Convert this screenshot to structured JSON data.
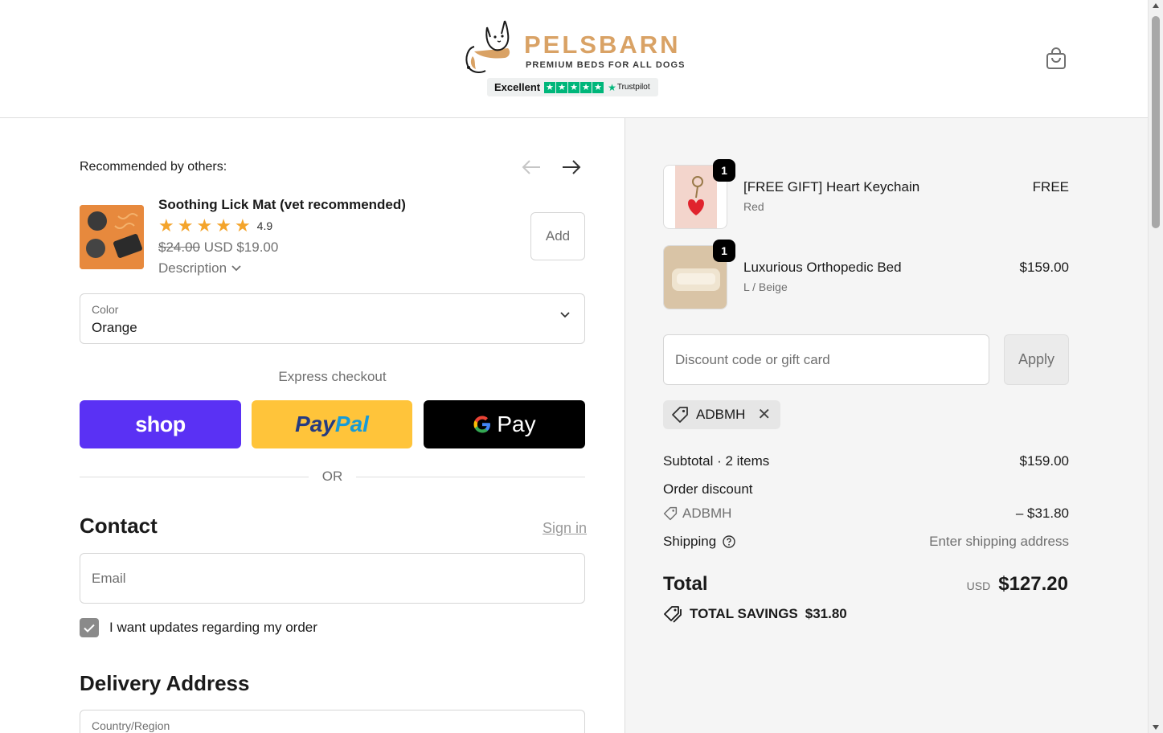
{
  "header": {
    "brand_name": "PELSBARN",
    "brand_tagline": "PREMIUM BEDS FOR ALL DOGS",
    "trustpilot": {
      "rating_text": "Excellent",
      "stars": 5,
      "brand": "Trustpilot",
      "star_color": "#00b67a"
    },
    "cart_icon": "shopping-bag-icon"
  },
  "recommended": {
    "title": "Recommended by others:",
    "product": {
      "name": "Soothing Lick Mat (vet recommended)",
      "rating": "4.9",
      "stars": 5,
      "price_original": "$24.00",
      "price_current": "USD $19.00",
      "description_label": "Description",
      "add_label": "Add"
    },
    "color_select": {
      "label": "Color",
      "value": "Orange"
    }
  },
  "express": {
    "title": "Express checkout",
    "shop_label": "shop",
    "paypal_part1": "Pay",
    "paypal_part2": "Pal",
    "gpay_label": "Pay",
    "or_label": "OR",
    "colors": {
      "shop": "#5a31f4",
      "paypal": "#ffc43a",
      "gpay": "#000000"
    }
  },
  "contact": {
    "title": "Contact",
    "signin_label": "Sign in",
    "email_placeholder": "Email",
    "updates_label": "I want updates regarding my order",
    "updates_checked": true
  },
  "delivery": {
    "title": "Delivery Address",
    "country_label": "Country/Region"
  },
  "order": {
    "items": [
      {
        "qty": "1",
        "name": "[FREE GIFT] Heart Keychain",
        "variant": "Red",
        "price": "FREE"
      },
      {
        "qty": "1",
        "name": "Luxurious Orthopedic Bed",
        "variant": "L / Beige",
        "price": "$159.00"
      }
    ],
    "discount_placeholder": "Discount code or gift card",
    "apply_label": "Apply",
    "applied_code": "ADBMH",
    "subtotal_label": "Subtotal · 2 items",
    "subtotal_value": "$159.00",
    "order_discount_label": "Order discount",
    "order_discount_code": "ADBMH",
    "order_discount_value": "– $31.80",
    "shipping_label": "Shipping",
    "shipping_value": "Enter shipping address",
    "total_label": "Total",
    "total_currency": "USD",
    "total_value": "$127.20",
    "savings_label": "TOTAL SAVINGS",
    "savings_value": "$31.80"
  }
}
